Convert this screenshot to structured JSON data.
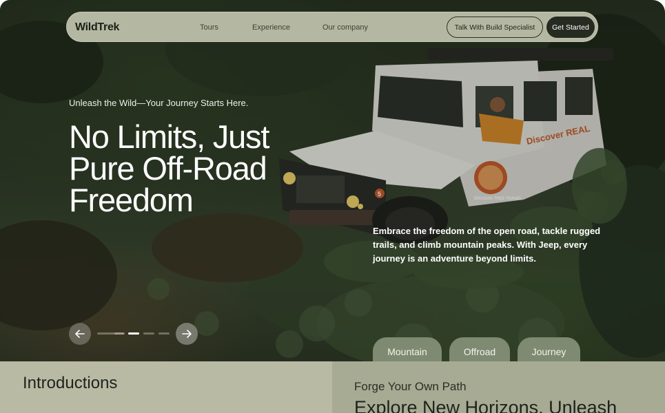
{
  "nav": {
    "logo": "WildTrek",
    "links": [
      "Tours",
      "Experience",
      "Our company"
    ],
    "specialist_button": "Talk With Build Specialist",
    "start_button": "Get Started"
  },
  "hero": {
    "eyebrow": "Unleash the Wild—Your Journey Starts Here.",
    "headline": "No Limits, Just Pure Off-Road Freedom",
    "description": "Embrace the freedom of the open road, tackle rugged trails, and climb mountain peaks. With Jeep, every journey is an adventure beyond limits.",
    "carousel": {
      "current_slide": 3,
      "total_slides": 5
    },
    "tags": [
      "Mountain",
      "Offroad",
      "Journey"
    ]
  },
  "sections": {
    "intro_title": "Introductions",
    "forge_subtitle": "Forge Your Own Path",
    "forge_title": "Explore New Horizons, Unleash"
  },
  "vehicle": {
    "marking_discover": "Discover REAL",
    "marking_badge": "DRAGON TREE TRAVEL",
    "plate_number": "5"
  },
  "colors": {
    "nav_bg": "#b4b8a2",
    "dark": "#262b22",
    "pill_bg": "#7e8a71",
    "section_left": "#b8baa4",
    "section_right": "#a7ab94"
  },
  "icons": [
    "arrow-left-icon",
    "arrow-right-icon"
  ]
}
